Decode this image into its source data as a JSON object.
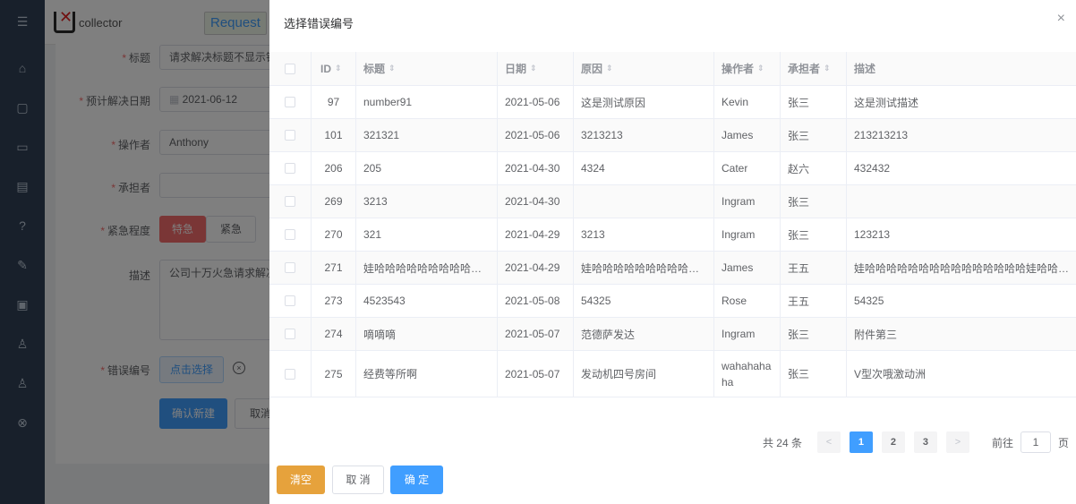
{
  "app": {
    "logo_text": "collector",
    "request_tab": "Request"
  },
  "sidebar": {
    "icons": [
      "menu-icon",
      "home-icon",
      "document-icon",
      "message-icon",
      "list-icon",
      "help-icon",
      "edit-icon",
      "folder-icon",
      "user-icon",
      "user-icon",
      "close-circle-icon"
    ]
  },
  "form": {
    "title_label": "标题",
    "title_value": "请求解决标题不显示错",
    "date_label": "预计解决日期",
    "date_value": "2021-06-12",
    "operator_label": "操作者",
    "operator_value": "Anthony",
    "assignee_label": "承担者",
    "urgency_label": "紧急程度",
    "urgency_options": [
      "特急",
      "紧急"
    ],
    "desc_label": "描述",
    "desc_value": "公司十万火急请求解决",
    "error_label": "错误编号",
    "pick_button": "点击选择",
    "confirm_button": "确认新建",
    "cancel_button": "取消"
  },
  "drawer": {
    "title": "选择错误编号",
    "close": "×",
    "columns": {
      "id": "ID",
      "title": "标题",
      "date": "日期",
      "reason": "原因",
      "operator": "操作者",
      "assignee": "承担者",
      "desc": "描述"
    },
    "rows": [
      {
        "id": "97",
        "title": "number91",
        "date": "2021-05-06",
        "reason": "这是测试原因",
        "operator": "Kevin",
        "assignee": "张三",
        "desc": "这是测试描述"
      },
      {
        "id": "101",
        "title": "321321",
        "date": "2021-05-06",
        "reason": "3213213",
        "operator": "James",
        "assignee": "张三",
        "desc": "213213213"
      },
      {
        "id": "206",
        "title": "205",
        "date": "2021-04-30",
        "reason": "4324",
        "operator": "Cater",
        "assignee": "赵六",
        "desc": "432432"
      },
      {
        "id": "269",
        "title": "3213",
        "date": "2021-04-30",
        "reason": "",
        "operator": "Ingram",
        "assignee": "张三",
        "desc": ""
      },
      {
        "id": "270",
        "title": "321",
        "date": "2021-04-29",
        "reason": "3213",
        "operator": "Ingram",
        "assignee": "张三",
        "desc": "123213"
      },
      {
        "id": "271",
        "title": "娃哈哈哈哈哈哈哈哈哈哈…",
        "date": "2021-04-29",
        "reason": "娃哈哈哈哈哈哈哈哈哈…",
        "operator": "James",
        "assignee": "王五",
        "desc": "娃哈哈哈哈哈哈哈哈哈哈哈哈哈哈哈娃哈哈…"
      },
      {
        "id": "273",
        "title": "4523543",
        "date": "2021-05-08",
        "reason": "54325",
        "operator": "Rose",
        "assignee": "王五",
        "desc": "54325"
      },
      {
        "id": "274",
        "title": "嘀嘀嘀",
        "date": "2021-05-07",
        "reason": "范德萨发达",
        "operator": "Ingram",
        "assignee": "张三",
        "desc": "附件第三"
      },
      {
        "id": "275",
        "title": "经费等所啊",
        "date": "2021-05-07",
        "reason": "发动机四号房间",
        "operator": "wahahahaha",
        "assignee": "张三",
        "desc": "V型次哦激动洲"
      }
    ],
    "pagination": {
      "total": "共 24 条",
      "prev": "<",
      "pages": [
        "1",
        "2",
        "3"
      ],
      "current": "1",
      "next": ">",
      "goto_label": "前往",
      "goto_value": "1",
      "page_unit": "页"
    },
    "buttons": {
      "clear": "清空",
      "cancel": "取 消",
      "ok": "确 定"
    }
  }
}
